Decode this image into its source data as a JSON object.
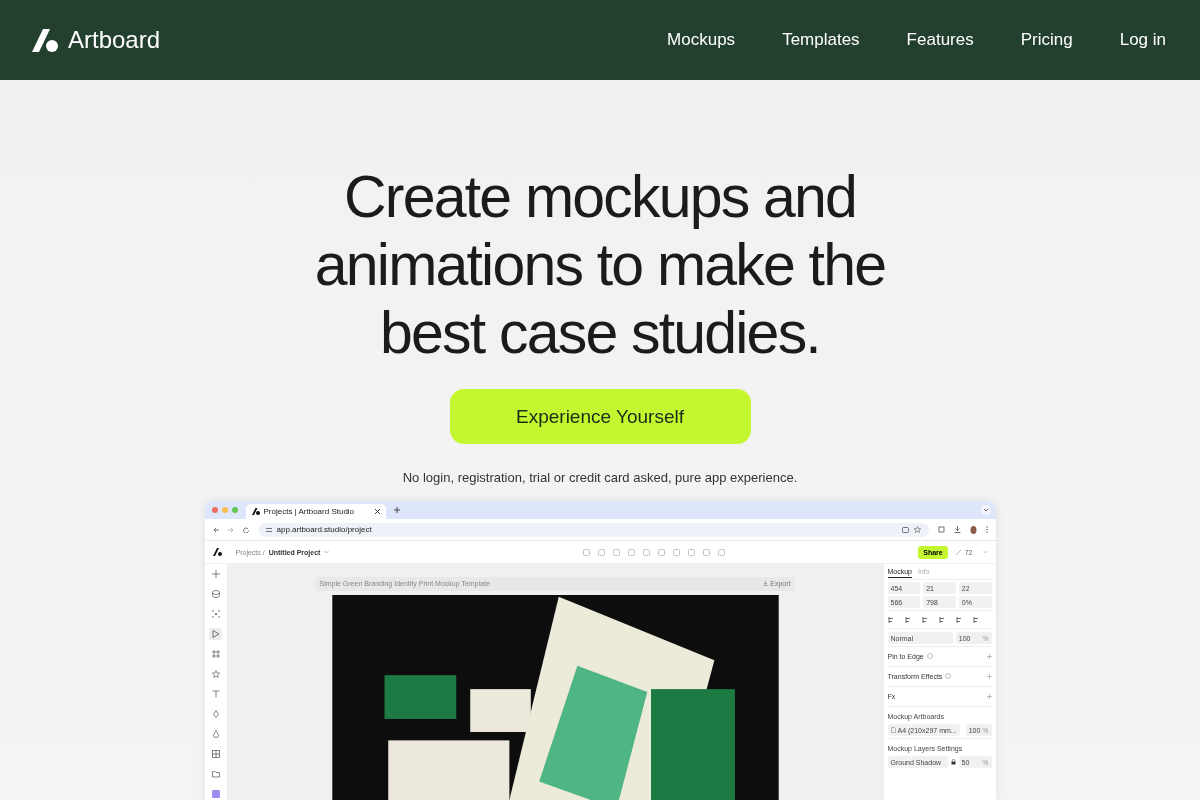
{
  "header": {
    "brand": "Artboard",
    "nav": [
      "Mockups",
      "Templates",
      "Features",
      "Pricing",
      "Log in"
    ]
  },
  "hero": {
    "title": "Create mockups and animations to make the best case studies.",
    "cta": "Experience Yourself",
    "note": "No login, registration, trial or credit card asked, pure app experience."
  },
  "browser": {
    "tab": "Projects | Artboard Studio",
    "url": "app.artboard.studio/project",
    "app": {
      "breadcrumb_root": "Projects /",
      "project": "Untitled Project",
      "share": "Share",
      "zoom": "72",
      "tools": [
        {
          "kind": "plus",
          "selected": false
        },
        {
          "kind": "stack",
          "selected": false
        },
        {
          "kind": "sparkle",
          "selected": false
        },
        {
          "kind": "pointer",
          "selected": true
        },
        {
          "kind": "frame",
          "selected": false
        },
        {
          "kind": "star",
          "selected": false
        },
        {
          "kind": "text",
          "selected": false
        },
        {
          "kind": "pen",
          "selected": false
        },
        {
          "kind": "drop",
          "selected": false
        },
        {
          "kind": "grid",
          "selected": false
        },
        {
          "kind": "folder",
          "selected": false
        },
        {
          "kind": "app",
          "selected": false
        }
      ],
      "canvas": {
        "title": "Simple Green Branding Identity Print Mockup Template",
        "export": "Export"
      },
      "panel": {
        "tabs": [
          {
            "label": "Mockup",
            "selected": true
          },
          {
            "label": "Info",
            "selected": false
          }
        ],
        "rows": [
          {
            "kind": "fields",
            "fields": [
              "454",
              "21",
              "22"
            ]
          },
          {
            "kind": "fields",
            "fields": [
              "566",
              "798",
              "0%"
            ]
          },
          {
            "kind": "align"
          },
          {
            "kind": "blend",
            "mode": "Normal",
            "value": "100",
            "unit": "%"
          },
          {
            "kind": "section",
            "label": "Pin to Edge",
            "info": true
          },
          {
            "kind": "section",
            "label": "Transform Effects",
            "info": true
          },
          {
            "kind": "section",
            "label": "Fx",
            "info": false
          },
          {
            "kind": "heading",
            "label": "Mockup Artboards"
          },
          {
            "kind": "artboard",
            "name": "A4 (210x297 mm...",
            "value": "100",
            "unit": "%"
          },
          {
            "kind": "heading",
            "label": "Mockup Layers Settings"
          },
          {
            "kind": "layer",
            "name": "Ground Shadow",
            "value": "50",
            "unit": "%"
          }
        ]
      }
    }
  }
}
